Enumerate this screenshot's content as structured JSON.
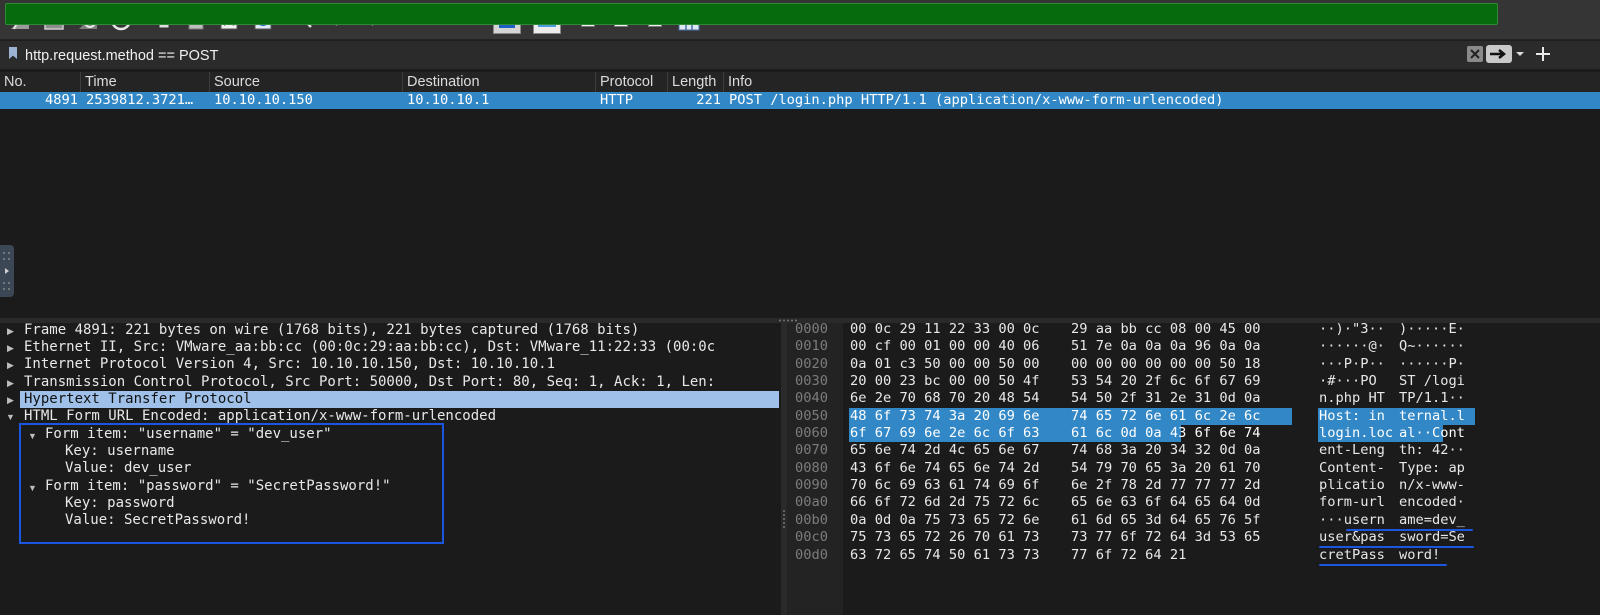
{
  "toolbar": {
    "items": [
      "shark-fin-icon",
      "stop-capture-icon",
      "restart-capture-icon",
      "capture-options-icon",
      "open-file-icon",
      "save-file-icon",
      "close-file-icon",
      "reload-file-icon",
      "find-packet-icon",
      "go-back-icon",
      "go-forward-icon",
      "go-to-packet-icon",
      "first-packet-icon",
      "last-packet-icon",
      "autoscroll-icon",
      "colorize-icon",
      "zoom-in-icon",
      "zoom-out-icon",
      "normal-size-icon",
      "resize-columns-icon"
    ]
  },
  "filter": {
    "value": "http.request.method == POST"
  },
  "columns": [
    "No.",
    "Time",
    "Source",
    "Destination",
    "Protocol",
    "Length",
    "Info"
  ],
  "selected_packet": {
    "no": "4891",
    "time": "2539812.3721…",
    "source": "10.10.10.150",
    "destination": "10.10.10.1",
    "protocol": "HTTP",
    "length": "221",
    "info": "POST /login.php HTTP/1.1  (application/x-www-form-urlencoded)"
  },
  "details": {
    "frame": "Frame 4891: 221 bytes on wire (1768 bits), 221 bytes captured (1768 bits)",
    "ethernet": "Ethernet II, Src: VMware_aa:bb:cc (00:0c:29:aa:bb:cc), Dst: VMware_11:22:33 (00:0c",
    "ip": "Internet Protocol Version 4, Src: 10.10.10.150, Dst: 10.10.10.1",
    "tcp": "Transmission Control Protocol, Src Port: 50000, Dst Port: 80, Seq: 1, Ack: 1, Len:",
    "http": "Hypertext Transfer Protocol",
    "form": "HTML Form URL Encoded: application/x-www-form-urlencoded",
    "item1": "Form item: \"username\" = \"dev_user\"",
    "item1_key": "Key: username",
    "item1_value": "Value: dev_user",
    "item2": "Form item: \"password\" = \"SecretPassword!\"",
    "item2_key": "Key: password",
    "item2_value": "Value: SecretPassword!"
  },
  "hex": {
    "offsets": [
      "0000",
      "0010",
      "0020",
      "0030",
      "0040",
      "0050",
      "0060",
      "0070",
      "0080",
      "0090",
      "00a0",
      "00b0",
      "00c0",
      "00d0"
    ],
    "bytes_a": [
      "00 0c 29 11 22 33 00 0c",
      "00 cf 00 01 00 00 40 06",
      "0a 01 c3 50 00 00 50 00",
      "20 00 23 bc 00 00 50 4f",
      "6e 2e 70 68 70 20 48 54",
      "48 6f 73 74 3a 20 69 6e",
      "6f 67 69 6e 2e 6c 6f 63",
      "65 6e 74 2d 4c 65 6e 67",
      "43 6f 6e 74 65 6e 74 2d",
      "70 6c 69 63 61 74 69 6f",
      "66 6f 72 6d 2d 75 72 6c",
      "0a 0d 0a 75 73 65 72 6e",
      "75 73 65 72 26 70 61 73",
      "63 72 65 74 50 61 73 73"
    ],
    "bytes_b": [
      "29 aa bb cc 08 00 45 00",
      "51 7e 0a 0a 0a 96 0a 0a",
      "00 00 00 00 00 00 50 18",
      "53 54 20 2f 6c 6f 67 69",
      "54 50 2f 31 2e 31 0d 0a",
      "74 65 72 6e 61 6c 2e 6c",
      "61 6c 0d 0a 43 6f 6e 74",
      "74 68 3a 20 34 32 0d 0a",
      "54 79 70 65 3a 20 61 70",
      "6e 2f 78 2d 77 77 77 2d",
      "65 6e 63 6f 64 65 64 0d",
      "61 6d 65 3d 64 65 76 5f",
      "73 77 6f 72 64 3d 53 65",
      "77 6f 72 64 21"
    ],
    "ascii_a": [
      "··)·\"3··",
      "······@·",
      "···P·P··",
      "·#···PO",
      "n.php HT",
      "Host: in",
      "login.loc",
      "ent-Leng",
      "Content-",
      "plicatio",
      "form-url",
      "···usern",
      "user&pas",
      "cretPass"
    ],
    "ascii_b": [
      ")·····E·",
      "Q~······",
      "······P·",
      "ST /logi",
      "TP/1.1··",
      "ternal.l",
      "al··Cont",
      "th: 42··",
      "Type: ap",
      "n/x-www-",
      "encoded·",
      "ame=dev_",
      "sword=Se",
      "word!"
    ]
  }
}
